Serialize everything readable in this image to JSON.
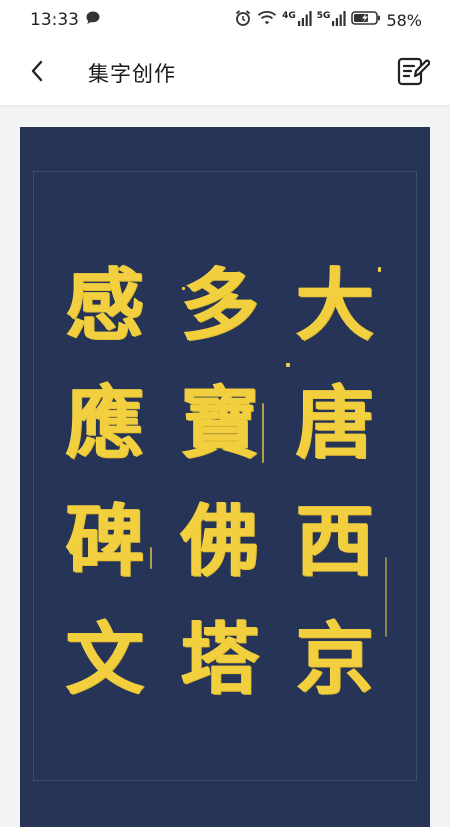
{
  "status_bar": {
    "time": "13:33",
    "network_1": "4G",
    "network_2": "5G",
    "battery": "58%"
  },
  "app_bar": {
    "title": "集字创作"
  },
  "colors": {
    "canvas_background": "#263457",
    "calligraphy_gold": "#f2cf3e"
  },
  "calligraphy": {
    "columns": [
      [
        "大",
        "唐",
        "西",
        "京"
      ],
      [
        "多",
        "寶",
        "佛",
        "塔"
      ],
      [
        "感",
        "應",
        "碑",
        "文"
      ]
    ]
  },
  "icons": {
    "message": "chat-bubble-icon",
    "alarm": "alarm-icon",
    "wifi": "wifi-icon",
    "signal": "signal-icon",
    "battery": "battery-charging-icon",
    "back": "chevron-left-icon",
    "edit": "edit-note-icon"
  }
}
